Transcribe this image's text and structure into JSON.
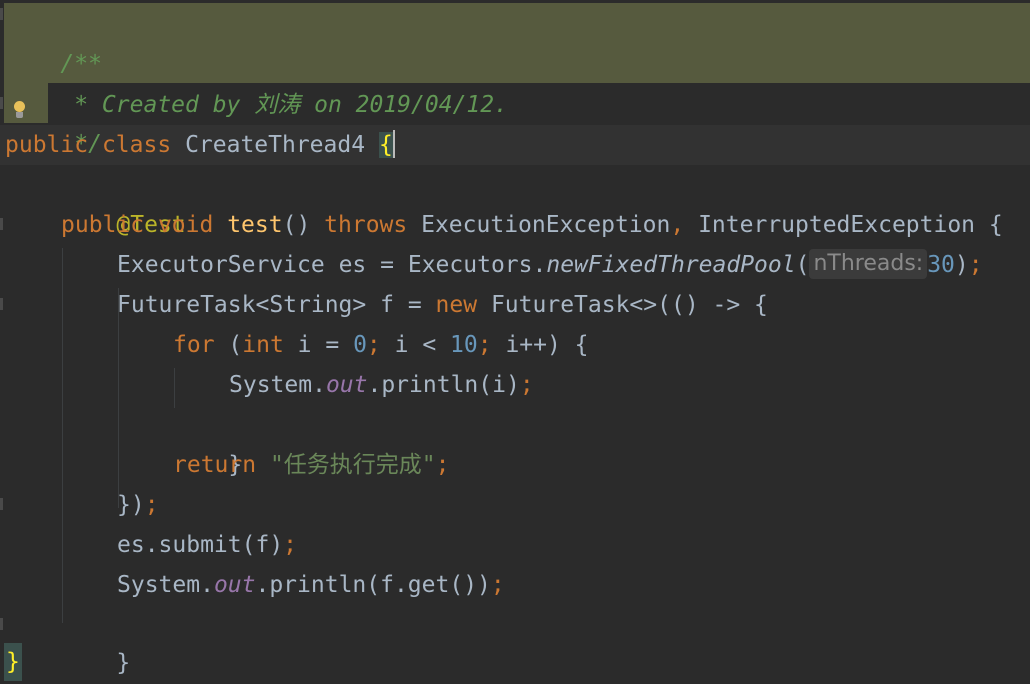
{
  "editor": {
    "doc_comment": {
      "open": "/**",
      "body": " * Created by 刘涛 on 2019/04/12.",
      "close": " */"
    },
    "class_decl": {
      "modifier": "public",
      "keyword": "class",
      "name": "CreateThread4",
      "open_brace": "{"
    },
    "annotation": "@Test",
    "method_decl": {
      "modifier": "public",
      "return_type": "void",
      "name": "test",
      "parens": "()",
      "throws": "throws",
      "exception1": "ExecutionException",
      "comma": ",",
      "exception2": "InterruptedException",
      "open_brace": "{"
    },
    "executor_line": {
      "type": "ExecutorService",
      "var": "es",
      "assign": "=",
      "receiver": "Executors.",
      "call": "newFixedThreadPool",
      "open_paren": "(",
      "param_hint": "nThreads:",
      "arg": "30",
      "close_paren": ")",
      "semi": ";"
    },
    "future_line": {
      "type": "FutureTask<String>",
      "var": "f",
      "assign": "=",
      "new_kw": "new",
      "ctor": "FutureTask<>(() -> {"
    },
    "for_line": {
      "keyword": "for",
      "open": "(",
      "int_kw": "int",
      "init": "i = ",
      "zero": "0",
      "semi1": ";",
      "cond": " i < ",
      "ten": "10",
      "semi2": ";",
      "incr": " i++) {"
    },
    "print_i_line": {
      "receiver": "System.",
      "field": "out",
      "call": ".println(i)",
      "semi": ";"
    },
    "for_close": "}",
    "return_line": {
      "keyword": "return",
      "value": "\"任务执行完成\"",
      "semi": ";"
    },
    "lambda_close": {
      "text": "})",
      "semi": ";"
    },
    "submit_line": {
      "text": "es.submit(f)",
      "semi": ";"
    },
    "print_get_line": {
      "receiver": "System.",
      "field": "out",
      "call": ".println(f.get())",
      "semi": ";"
    },
    "method_close": "}",
    "class_close": "}"
  },
  "colors": {
    "background": "#2b2b2b",
    "keyword": "#cc7832",
    "doc_comment": "#629755",
    "annotation": "#bbb529",
    "method_name": "#ffc66d",
    "number": "#6897bb",
    "string": "#6a8759",
    "static_field": "#9876aa",
    "text": "#a9b7c6"
  }
}
